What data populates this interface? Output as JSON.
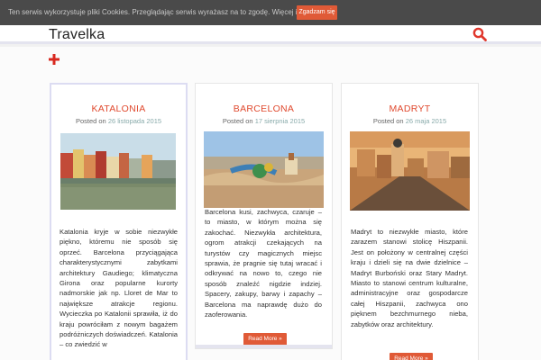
{
  "cookie": {
    "text": "Ten serwis wykorzystuje pliki Cookies. Przeglądając serwis wyrażasz na to zgodę.",
    "more_link": "Więcej info",
    "accept_label": "Zgadzam się"
  },
  "header": {
    "site_title": "Travelka",
    "search_icon": "search-icon"
  },
  "toolbar": {
    "plus_icon": "plus-icon"
  },
  "posts": [
    {
      "title": "KATALONIA",
      "posted_prefix": "Posted on",
      "date": "26 listopada 2015",
      "excerpt": "Katalonia kryje w sobie niezwykłe piękno, któremu nie sposób się oprzeć. Barcelona przyciągająca charakterystycznymi zabytkami architektury Gaudiego; klimatyczna Girona oraz popularne kurorty nadmorskie jak np. Lloret de Mar to największe atrakcje regionu. Wycieczka po Katalonii sprawiła, iż do kraju powróciłam z nowym bagażem podróżniczych doświadczeń. Katalonia – co zwiedzić w"
    },
    {
      "title": "BARCELONA",
      "posted_prefix": "Posted on",
      "date": "17 sierpnia 2015",
      "excerpt": "Barcelona kusi, zachwyca, czaruje – to miasto, w którym można się zakochać. Niezwykła architektura, ogrom atrakcji czekających na turystów czy magicznych miejsc sprawia, że pragnie się tutaj wracać i odkrywać na nowo to, czego nie sposób znaleźć nigdzie indziej. Spacery, zakupy, barwy i zapachy – Barcelona ma naprawdę dużo do zaoferowania.",
      "read_more": "Read More »"
    },
    {
      "title": "MADRYT",
      "posted_prefix": "Posted on",
      "date": "26 maja 2015",
      "excerpt": "Madryt to niezwykłe miasto, które zarazem stanowi stolicę Hiszpanii. Jest on położony w centralnej części kraju i dzieli się na dwie dzielnice – Madryt Burboński oraz Stary Madryt. Miasto to stanowi centrum kulturalne, administracyjne oraz gospodarcze całej Hiszpanii, zachwyca ono pięknem bezchmurnego nieba, zabytków oraz architektury.",
      "read_more": "Read More »"
    }
  ],
  "colors": {
    "accent": "#e05a37",
    "title_red": "#e04a2f",
    "cookie_bg": "#4a4a4a"
  }
}
